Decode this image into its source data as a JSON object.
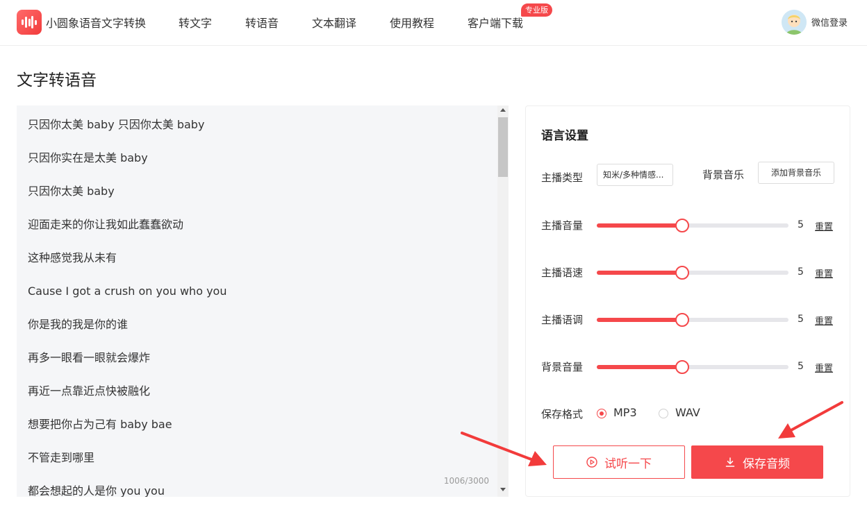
{
  "header": {
    "brand": "小圆象语音文字转换",
    "nav": [
      "转文字",
      "转语音",
      "文本翻译",
      "使用教程",
      "客户端下载"
    ],
    "pro_badge": "专业版",
    "login": "微信登录"
  },
  "page": {
    "title": "文字转语音"
  },
  "editor": {
    "lines": [
      "只因你太美 baby 只因你太美 baby",
      "只因你实在是太美 baby",
      "只因你太美 baby",
      "迎面走来的你让我如此蠢蠢欲动",
      "这种感觉我从未有",
      "Cause I got a crush on you who you",
      "你是我的我是你的谁",
      "再多一眼看一眼就会爆炸",
      "再近一点靠近点快被融化",
      "想要把你占为己有 baby bae",
      "不管走到哪里",
      "都会想起的人是你 you you"
    ],
    "char_count": "1006/3000"
  },
  "settings": {
    "title": "语言设置",
    "anchor_type_label": "主播类型",
    "anchor_type_value": "知米/多种情感...",
    "bgm_label": "背景音乐",
    "bgm_button": "添加背景音乐",
    "sliders": [
      {
        "label": "主播音量",
        "value": "5",
        "fraction": 0.447,
        "reset": "重置"
      },
      {
        "label": "主播语速",
        "value": "5",
        "fraction": 0.447,
        "reset": "重置"
      },
      {
        "label": "主播语调",
        "value": "5",
        "fraction": 0.447,
        "reset": "重置"
      },
      {
        "label": "背景音量",
        "value": "5",
        "fraction": 0.447,
        "reset": "重置"
      }
    ],
    "format_label": "保存格式",
    "formats": [
      {
        "label": "MP3",
        "selected": true
      },
      {
        "label": "WAV",
        "selected": false
      }
    ],
    "listen_button": "试听一下",
    "save_button": "保存音频"
  },
  "colors": {
    "accent": "#f5484b",
    "panel_bg": "#f5f6f8"
  }
}
